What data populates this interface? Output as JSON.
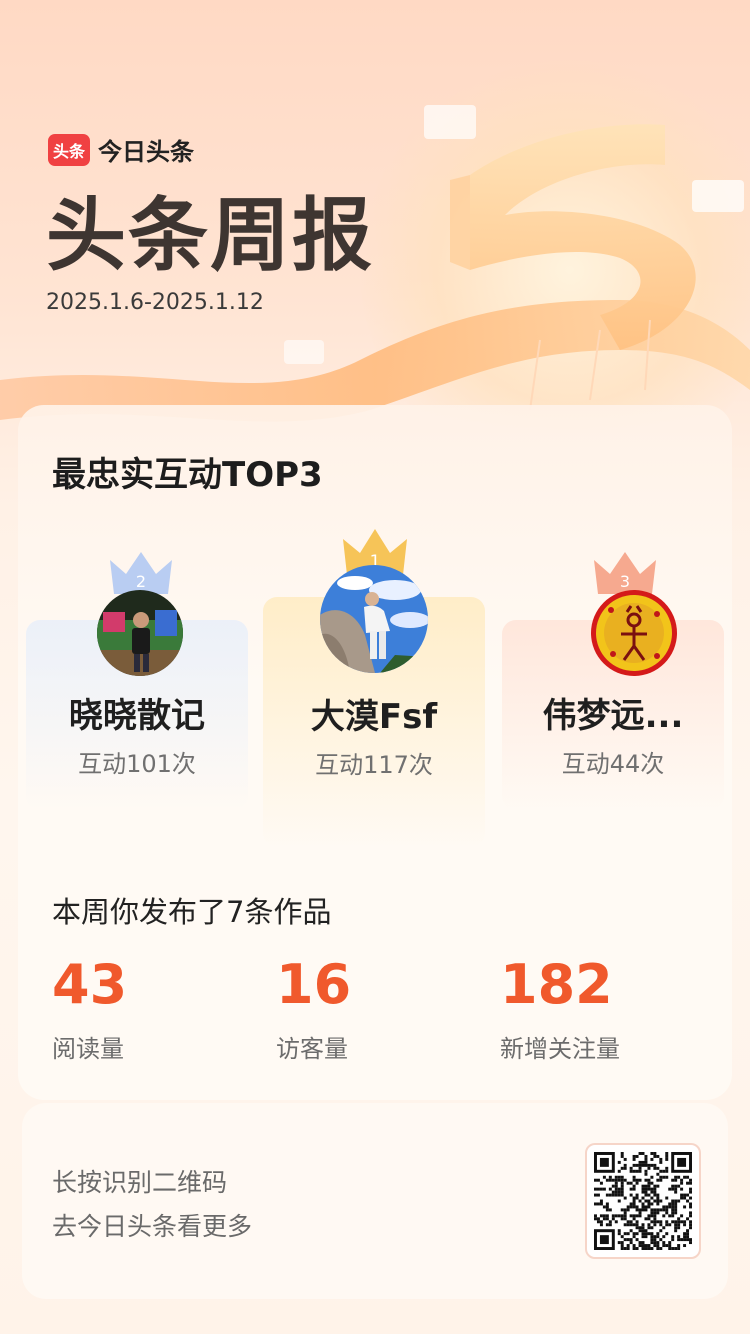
{
  "brand": {
    "logo_text": "头条",
    "name": "今日头条"
  },
  "header": {
    "title": "头条周报",
    "date_range": "2025.1.6-2025.1.12"
  },
  "top_fans": {
    "title": "最忠实互动TOP3",
    "items": [
      {
        "rank": "2",
        "name": "晓晓散记",
        "count_text": "互动101次"
      },
      {
        "rank": "1",
        "name": "大漠Fsf",
        "count_text": "互动117次"
      },
      {
        "rank": "3",
        "name": "伟梦远...",
        "count_text": "互动44次"
      }
    ]
  },
  "weekly": {
    "summary": "本周你发布了7条作品",
    "stats": [
      {
        "value": "43",
        "label": "阅读量"
      },
      {
        "value": "16",
        "label": "访客量"
      },
      {
        "value": "182",
        "label": "新增关注量"
      }
    ]
  },
  "footer": {
    "line1": "长按识别二维码",
    "line2": "去今日头条看更多"
  },
  "colors": {
    "accent": "#f0592c",
    "brand_red": "#f04142",
    "gold_crown": "#f6c458",
    "silver_crown": "#b9cdf2",
    "bronze_crown": "#f6a98f"
  }
}
